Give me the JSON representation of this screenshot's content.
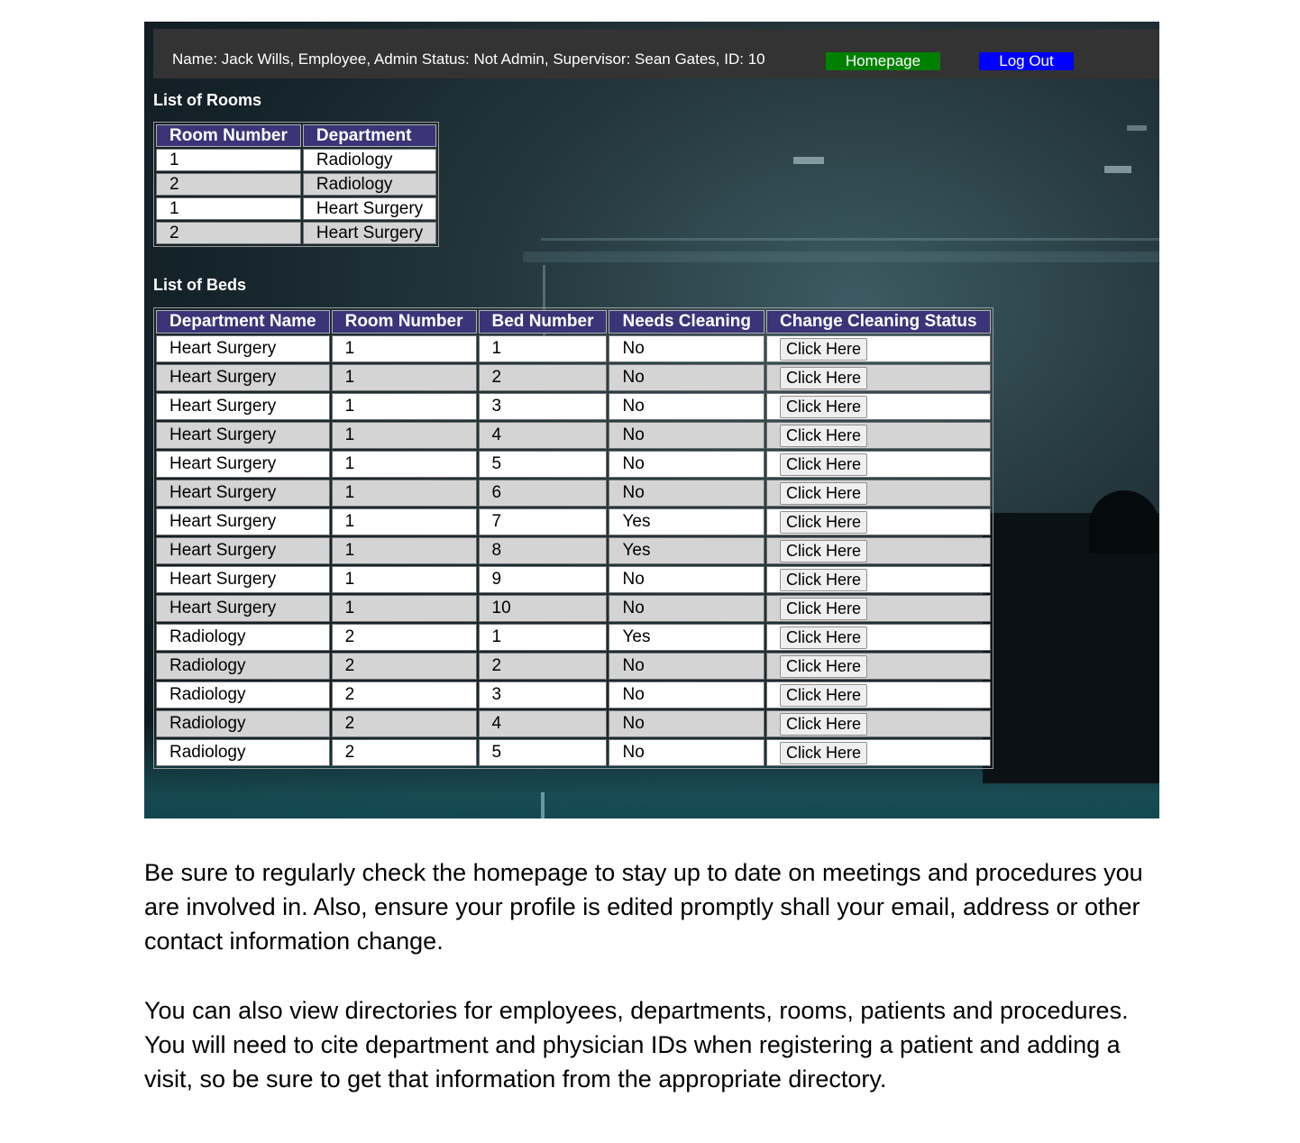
{
  "header": {
    "user_info": "Name: Jack Wills, Employee, Admin Status: Not Admin, Supervisor: Sean Gates, ID: 10",
    "homepage_button": "Homepage",
    "logout_button": "Log Out",
    "homepage_color": "#008000",
    "logout_color": "#0000ff"
  },
  "rooms": {
    "heading": "List of Rooms",
    "columns": [
      "Room Number",
      "Department"
    ],
    "rows": [
      [
        "1",
        "Radiology"
      ],
      [
        "2",
        "Radiology"
      ],
      [
        "1",
        "Heart Surgery"
      ],
      [
        "2",
        "Heart Surgery"
      ]
    ]
  },
  "beds": {
    "heading": "List of Beds",
    "columns": [
      "Department Name",
      "Room Number",
      "Bed Number",
      "Needs Cleaning",
      "Change Cleaning Status"
    ],
    "button_label": "Click Here",
    "rows": [
      [
        "Heart Surgery",
        "1",
        "1",
        "No"
      ],
      [
        "Heart Surgery",
        "1",
        "2",
        "No"
      ],
      [
        "Heart Surgery",
        "1",
        "3",
        "No"
      ],
      [
        "Heart Surgery",
        "1",
        "4",
        "No"
      ],
      [
        "Heart Surgery",
        "1",
        "5",
        "No"
      ],
      [
        "Heart Surgery",
        "1",
        "6",
        "No"
      ],
      [
        "Heart Surgery",
        "1",
        "7",
        "Yes"
      ],
      [
        "Heart Surgery",
        "1",
        "8",
        "Yes"
      ],
      [
        "Heart Surgery",
        "1",
        "9",
        "No"
      ],
      [
        "Heart Surgery",
        "1",
        "10",
        "No"
      ],
      [
        "Radiology",
        "2",
        "1",
        "Yes"
      ],
      [
        "Radiology",
        "2",
        "2",
        "No"
      ],
      [
        "Radiology",
        "2",
        "3",
        "No"
      ],
      [
        "Radiology",
        "2",
        "4",
        "No"
      ],
      [
        "Radiology",
        "2",
        "5",
        "No"
      ]
    ]
  },
  "instructions": {
    "paragraph1": "Be sure to regularly check the homepage to stay up to date on meetings and procedures you are involved in. Also, ensure your profile is edited promptly shall your email, address or other contact information change.",
    "paragraph2": "You can also view directories for employees, departments, rooms, patients and procedures. You will need to cite department and physician IDs when registering a patient and adding a visit, so be sure to get that information from the appropriate directory."
  },
  "colors": {
    "table_header": "#3b3478",
    "row_light": "#ffffff",
    "row_dark": "#d4d4d4"
  }
}
